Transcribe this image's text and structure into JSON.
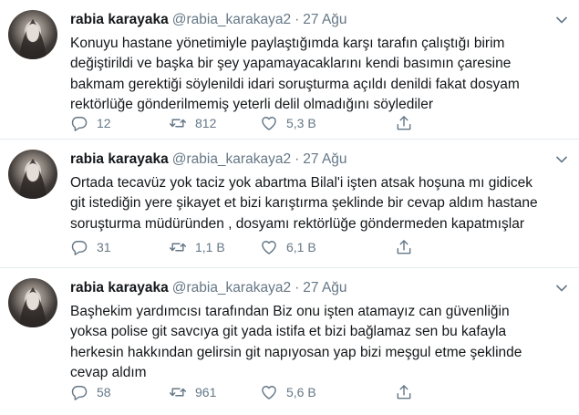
{
  "tweets": [
    {
      "name": "rabia karayaka",
      "handle": "@rabia_karakaya2",
      "separator": "·",
      "date": "27 Ağu",
      "lines": [
        "Konuyu hastane yönetimiyle paylaştığımda karşı tarafın çalıştığı birim",
        "değiştirildi ve başka bir şey yapamayacaklarını kendi basımın çaresine",
        "bakmam gerektiği söylenildi idari soruşturma açıldı denildi fakat dosyam",
        "rektörlüğe gönderilmemiş yeterli delil olmadığını söylediler"
      ],
      "replies": "12",
      "retweets": "812",
      "likes": "5,3 B"
    },
    {
      "name": "rabia karayaka",
      "handle": "@rabia_karakaya2",
      "separator": "·",
      "date": "27 Ağu",
      "lines": [
        "Ortada tecavüz yok taciz yok abartma Bilal'i işten atsak hoşuna mı gidicek",
        "git istediğin yere şikayet et bizi karıştırma şeklinde bir cevap aldım hastane",
        "soruşturma müdüründen , dosyamı rektörlüğe göndermeden kapatmışlar"
      ],
      "replies": "31",
      "retweets": "1,1 B",
      "likes": "6,1 B"
    },
    {
      "name": "rabia karayaka",
      "handle": "@rabia_karakaya2",
      "separator": "·",
      "date": "27 Ağu",
      "lines": [
        "Başhekim yardımcısı tarafından  Biz onu işten atamayız can güvenliğin",
        "yoksa polise git savcıya git yada istifa et bizi bağlamaz sen bu kafayla",
        "herkesin hakkından gelirsin git napıyosan yap bizi meşgul etme şeklinde",
        "cevap aldım"
      ],
      "replies": "58",
      "retweets": "961",
      "likes": "5,6 B"
    }
  ],
  "icons": {
    "reply": "reply-icon",
    "retweet": "retweet-icon",
    "like": "like-icon",
    "share": "share-icon",
    "more": "chevron-down-icon"
  },
  "colors": {
    "text": "#14171a",
    "secondary": "#657786",
    "divider": "#e6ecf0"
  }
}
